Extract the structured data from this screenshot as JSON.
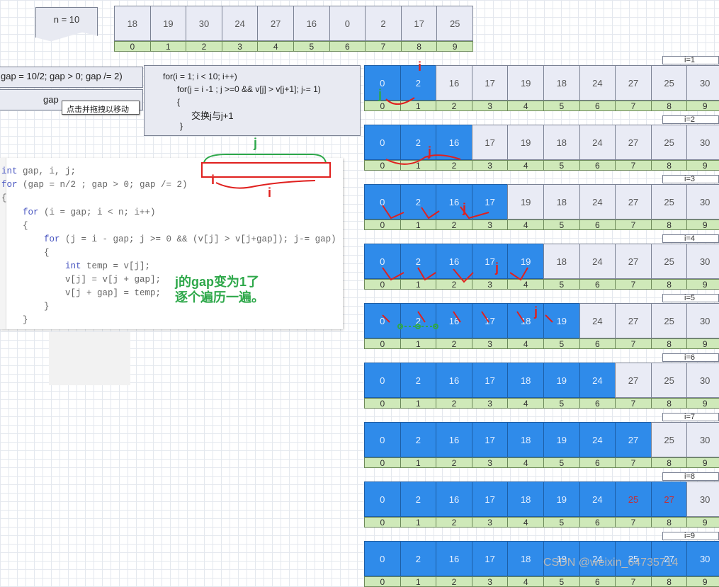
{
  "n_label": "n = 10",
  "initial_array": {
    "values": [
      "18",
      "19",
      "30",
      "24",
      "27",
      "16",
      "0",
      "2",
      "17",
      "25"
    ],
    "indices": [
      "0",
      "1",
      "2",
      "3",
      "4",
      "5",
      "6",
      "7",
      "8",
      "9"
    ]
  },
  "gap_line": "gap = 10/2; gap > 0; gap /= 2)",
  "gap_label": "gap",
  "tooltip": "点击并拖拽以移动",
  "loop_code": [
    "for(i = 1; i < 10; i++)",
    "for(j = i -1 ; j >=0 && v[j] > v[j+1]; j-= 1)",
    "{",
    "交换j与j+1",
    "}"
  ],
  "code_lines": [
    [
      "int",
      " gap, i, j;"
    ],
    [
      "for",
      " (gap = n/2 ; gap > 0; gap /= 2)"
    ],
    [
      "",
      "{"
    ],
    [
      "for",
      " (i = gap; i < n; i++)"
    ],
    [
      "",
      "{"
    ],
    [
      "for",
      " (j = i - gap; j >= 0 && (v[j] > v[j+gap]); j-= gap)"
    ],
    [
      "",
      "{"
    ],
    [
      "int",
      " temp = v[j];"
    ],
    [
      "",
      "v[j] = v[j + gap];"
    ],
    [
      "",
      "v[j + gap] = temp;"
    ],
    [
      "",
      "}"
    ],
    [
      "",
      "}"
    ]
  ],
  "note": [
    "j的gap变为1了",
    "逐个遍历一遍。"
  ],
  "annotations": {
    "i": "i",
    "j": "j"
  },
  "steps": [
    {
      "label": "i=1",
      "values": [
        "0",
        "2",
        "16",
        "17",
        "19",
        "18",
        "24",
        "27",
        "25",
        "30"
      ],
      "blue": 2,
      "red": []
    },
    {
      "label": "i=2",
      "values": [
        "0",
        "2",
        "16",
        "17",
        "19",
        "18",
        "24",
        "27",
        "25",
        "30"
      ],
      "blue": 3,
      "red": []
    },
    {
      "label": "i=3",
      "values": [
        "0",
        "2",
        "16",
        "17",
        "19",
        "18",
        "24",
        "27",
        "25",
        "30"
      ],
      "blue": 4,
      "red": []
    },
    {
      "label": "i=4",
      "values": [
        "0",
        "2",
        "16",
        "17",
        "19",
        "18",
        "24",
        "27",
        "25",
        "30"
      ],
      "blue": 5,
      "red": []
    },
    {
      "label": "i=5",
      "values": [
        "0",
        "2",
        "16",
        "17",
        "18",
        "19",
        "24",
        "27",
        "25",
        "30"
      ],
      "blue": 6,
      "red": []
    },
    {
      "label": "i=6",
      "values": [
        "0",
        "2",
        "16",
        "17",
        "18",
        "19",
        "24",
        "27",
        "25",
        "30"
      ],
      "blue": 7,
      "red": []
    },
    {
      "label": "i=7",
      "values": [
        "0",
        "2",
        "16",
        "17",
        "18",
        "19",
        "24",
        "27",
        "25",
        "30"
      ],
      "blue": 8,
      "red": []
    },
    {
      "label": "i=8",
      "values": [
        "0",
        "2",
        "16",
        "17",
        "18",
        "19",
        "24",
        "25",
        "27",
        "30"
      ],
      "blue": 9,
      "red": [
        7,
        8
      ]
    },
    {
      "label": "i=9",
      "values": [
        "0",
        "2",
        "16",
        "17",
        "18",
        "19",
        "24",
        "25",
        "27",
        "30"
      ],
      "blue": 10,
      "red": []
    }
  ],
  "watermark": "CSDN @weixin_64735714",
  "colors": {
    "sorted": "#2f8bea",
    "unsorted": "#e9ebf5",
    "index": "#cfe9b9",
    "marker_red": "#e0201e",
    "marker_green": "#2ea84a"
  }
}
